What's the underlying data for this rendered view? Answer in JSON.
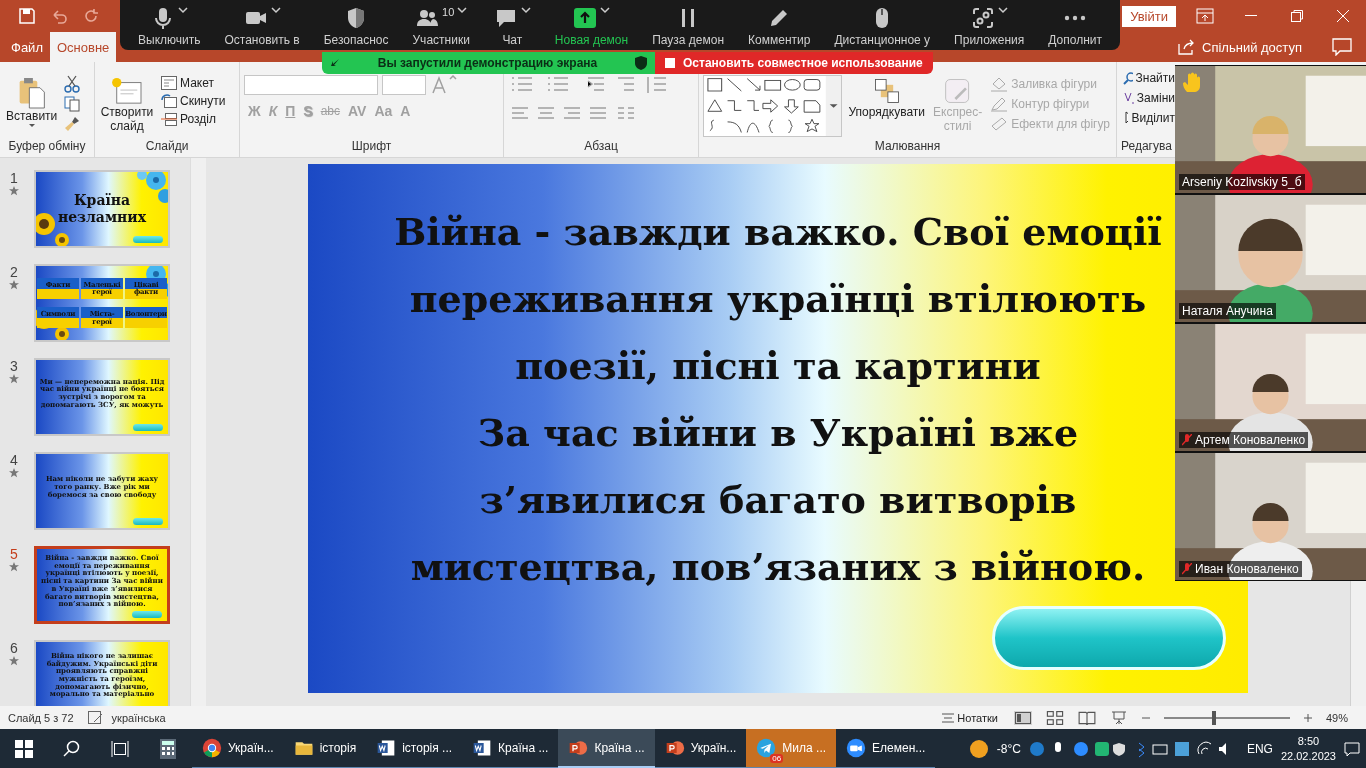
{
  "title_bar": {
    "signin": "Увійти"
  },
  "ribbon_tabs": [
    {
      "label": "Файл",
      "selected": false
    },
    {
      "label": "Основне",
      "selected": true
    }
  ],
  "share": "Спільний доступ",
  "zoom_toolbar": {
    "participants_count": "10",
    "items": [
      {
        "kind": "mic",
        "label": "Выключить",
        "caret": true,
        "active": false
      },
      {
        "kind": "video",
        "label": "Остановить в",
        "caret": true,
        "active": false
      },
      {
        "kind": "shield",
        "label": "Безопаснос",
        "caret": false,
        "active": false
      },
      {
        "kind": "people",
        "label": "Участники",
        "caret": true,
        "active": false
      },
      {
        "kind": "chat",
        "label": "Чат",
        "caret": true,
        "active": false
      },
      {
        "kind": "share",
        "label": "Новая демон",
        "caret": true,
        "active": true
      },
      {
        "kind": "pause",
        "label": "Пауза демон",
        "caret": false,
        "active": false
      },
      {
        "kind": "pen",
        "label": "Комментир",
        "caret": false,
        "active": false
      },
      {
        "kind": "mouse",
        "label": "Дистанционное у",
        "caret": false,
        "active": false
      },
      {
        "kind": "apps",
        "label": "Приложения",
        "caret": true,
        "active": false
      },
      {
        "kind": "more",
        "label": "Дополнит",
        "caret": false,
        "active": false
      }
    ]
  },
  "share_banner": {
    "status": "Вы запустили демонстрацию экрана",
    "stop": "Остановить совместное использование"
  },
  "ribbon": {
    "clipboard": {
      "title": "Буфер обміну",
      "paste": "Вставити"
    },
    "slides": {
      "title": "Слайди",
      "new_slide": "Створити слайд",
      "layout": "Макет",
      "reset": "Скинути",
      "section": "Розділ"
    },
    "font": {
      "title": "Шрифт",
      "disabled": true,
      "buttons": [
        {
          "kind": "bold",
          "label": "Ж"
        },
        {
          "kind": "italic",
          "label": "К"
        },
        {
          "kind": "underline",
          "label": "П"
        },
        {
          "kind": "shadow",
          "label": "S"
        },
        {
          "kind": "strike",
          "label": "abc"
        },
        {
          "kind": "spacing",
          "label": "AV"
        },
        {
          "kind": "case",
          "label": "Aa"
        },
        {
          "kind": "color",
          "label": "A"
        }
      ]
    },
    "paragraph": {
      "title": "Абзац"
    },
    "drawing": {
      "title": "Малювання",
      "arrange": "Упорядкувати",
      "quick_styles": "Експрес-стилі",
      "items": [
        {
          "kind": "fill",
          "label": "Заливка фігури",
          "disabled": true
        },
        {
          "kind": "outline",
          "label": "Контур фігури",
          "disabled": true
        },
        {
          "kind": "effects",
          "label": "Ефекти для фігур",
          "disabled": true
        }
      ]
    },
    "editing": {
      "title": "Редагува",
      "find": "Знайти",
      "replace": "Заміни",
      "select": "Виділит"
    }
  },
  "slides_panel": [
    {
      "number": "1",
      "selected": false,
      "kind": "title",
      "text": "Країна незламних"
    },
    {
      "number": "2",
      "selected": false,
      "kind": "flags",
      "flags": [
        "Факти",
        "Маленькі герої",
        "Цікаві факти",
        "Символи",
        "Міста-герої",
        "Волонтери"
      ]
    },
    {
      "number": "3",
      "selected": false,
      "kind": "text",
      "text": "Ми — непереможна нація. Під час війни українці не бояться зустрічі з ворогом та допомагають ЗСУ, як можуть"
    },
    {
      "number": "4",
      "selected": false,
      "kind": "text",
      "text": "Нам ніколи не забути жаху того ранку. Вже рік ми боремося за свою свободу"
    },
    {
      "number": "5",
      "selected": true,
      "kind": "text",
      "text": "Війна - завжди важко. Свої емоції та переживання українці втілюють у поезії, пісні та картини За час війни в Україні вже з’явилися багато витворів мистецтва, пов’язаних з війною."
    },
    {
      "number": "6",
      "selected": false,
      "kind": "text",
      "text": "Війна нікого не залишає байдужим. Українські діти проявляють справжні мужність та героїзм, допомагають фізично, морально та матеріально"
    }
  ],
  "slide": {
    "text": "Війна - завжди важко. Свої емоції\nпереживання українці втілюють\nпоезії, пісні та картини\nЗа час війни в Україні вже\nз’явилися багато витворів\nмистецтва, пов’язаних з війною."
  },
  "video_tiles": [
    {
      "name": "Arseniy Kozlivskiy 5_б",
      "muted": false,
      "hand_raised": true
    },
    {
      "name": "Наталя Анучина",
      "muted": false,
      "hand_raised": false
    },
    {
      "name": "Артем Коноваленко",
      "muted": true,
      "hand_raised": false
    },
    {
      "name": "Иван Коноваленко",
      "muted": true,
      "hand_raised": false
    }
  ],
  "status_bar": {
    "slide_counter": "Слайд 5 з 72",
    "language": "українська",
    "notes": "Нотатки",
    "zoom": "49%",
    "zoom_slider": {
      "level": 0.38
    }
  },
  "taskbar": {
    "apps": [
      {
        "kind": "chrome",
        "label": "Україн...",
        "selected": false,
        "attention": false
      },
      {
        "kind": "folder",
        "label": "історія",
        "selected": false,
        "attention": false
      },
      {
        "kind": "word",
        "label": "історія ...",
        "selected": false,
        "attention": false
      },
      {
        "kind": "word",
        "label": "Країна ...",
        "selected": false,
        "attention": false
      },
      {
        "kind": "ppt",
        "label": "Країна ...",
        "selected": true,
        "attention": false
      },
      {
        "kind": "ppt",
        "label": "Україн...",
        "selected": false,
        "attention": false
      },
      {
        "kind": "telegram",
        "label": "Мила ...",
        "selected": false,
        "attention": true,
        "badge": "06"
      },
      {
        "kind": "zoom",
        "label": "Елемен...",
        "selected": false,
        "attention": false
      }
    ],
    "weather": "-8°C",
    "language": "ENG",
    "time": "8:50",
    "date": "22.02.2023"
  }
}
